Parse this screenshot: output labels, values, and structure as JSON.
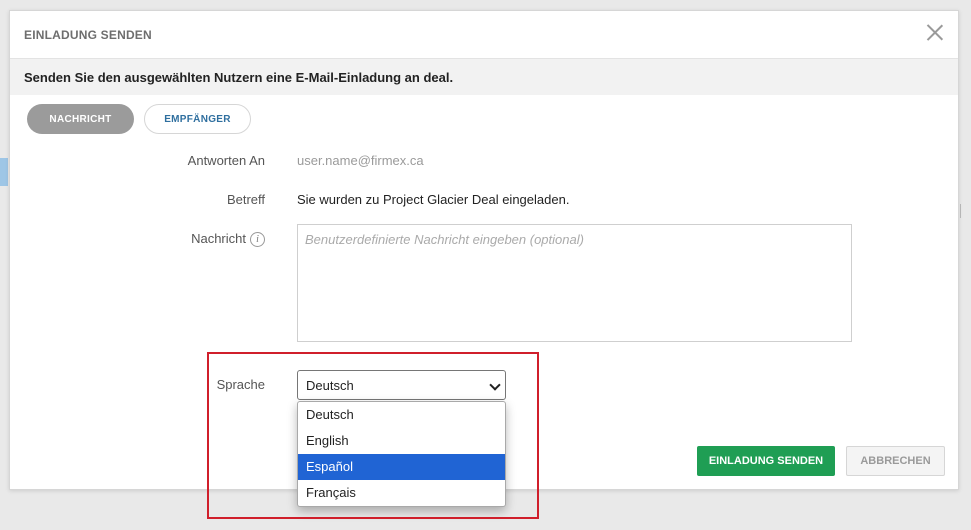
{
  "modal": {
    "title": "EINLADUNG SENDEN",
    "subheader": "Senden Sie den ausgewählten Nutzern eine E-Mail-Einladung an deal."
  },
  "tabs": [
    {
      "label": "NACHRICHT",
      "active": true
    },
    {
      "label": "EMPFÄNGER",
      "active": false
    }
  ],
  "form": {
    "reply_label": "Antworten An",
    "reply_value": "user.name@firmex.ca",
    "subject_label": "Betreff",
    "subject_value": "Sie wurden zu Project Glacier Deal eingeladen.",
    "message_label": "Nachricht",
    "message_placeholder": "Benutzerdefinierte Nachricht eingeben (optional)",
    "language_label": "Sprache",
    "language_selected": "Deutsch",
    "language_options": [
      "Deutsch",
      "English",
      "Español",
      "Français"
    ],
    "language_highlighted": "Español"
  },
  "buttons": {
    "send": "EINLADUNG SENDEN",
    "cancel": "ABBRECHEN"
  },
  "colors": {
    "send_button": "#1f9e54",
    "tab_active": "#9b9b9b",
    "option_highlight": "#2064d4",
    "annotation_box": "#d01f2b"
  },
  "icons": {
    "close": "close-icon",
    "info": "info-icon",
    "chevron": "chevron-down-icon"
  }
}
